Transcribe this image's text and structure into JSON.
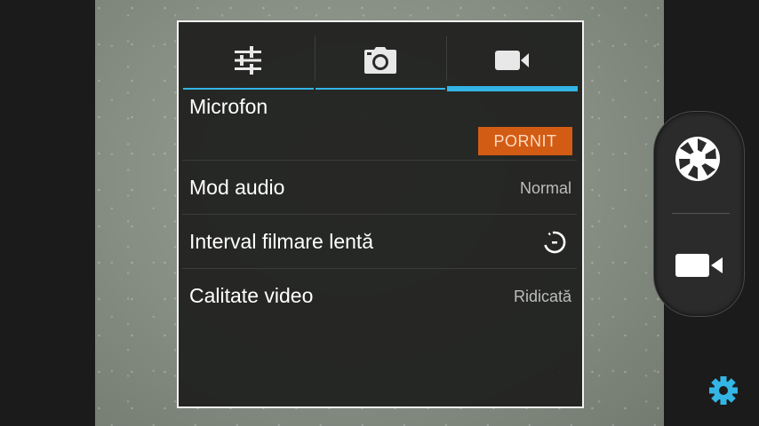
{
  "tabs": [
    {
      "icon": "sliders-icon",
      "active": false
    },
    {
      "icon": "camera-icon",
      "active": false
    },
    {
      "icon": "video-camera-icon",
      "active": true
    }
  ],
  "settings": {
    "microphone": {
      "label": "Microfon",
      "toggle_label": "PORNIT"
    },
    "audio_mode": {
      "label": "Mod audio",
      "value": "Normal"
    },
    "time_lapse": {
      "label": "Interval filmare lentă",
      "icon": "timer-icon"
    },
    "video_quality": {
      "label": "Calitate video",
      "value": "Ridicată"
    }
  },
  "controls": {
    "shutter_icon": "shutter-icon",
    "video_icon": "video-camera-icon",
    "settings_icon": "gear-icon"
  },
  "colors": {
    "accent": "#33b5e5",
    "toggle_on": "#d35c14",
    "gear": "#33b5e5"
  }
}
